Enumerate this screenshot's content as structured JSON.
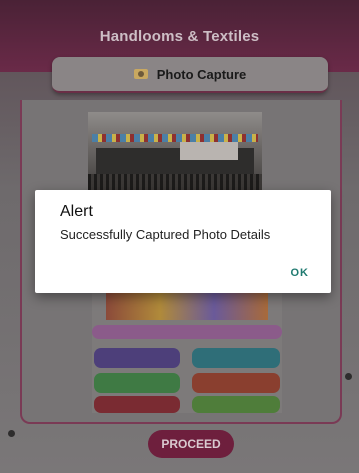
{
  "header": {
    "title": "Handlooms & Textiles"
  },
  "capture": {
    "icon": "camera-icon",
    "label": "Photo Capture"
  },
  "actions": {
    "proceed_label": "PROCEED"
  },
  "alert": {
    "title": "Alert",
    "message": "Successfully Captured Photo Details",
    "ok_label": "OK"
  },
  "colors": {
    "header": "#6a2a48",
    "accent": "#6e1f3d",
    "ok": "#1f7a70"
  }
}
